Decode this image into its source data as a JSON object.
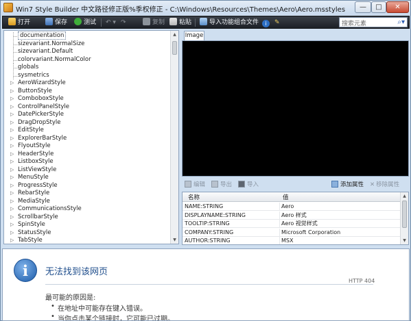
{
  "window": {
    "title": "Win7 Style Builder 中文路径修正版%季权修正 - C:\\Windows\\Resources\\Themes\\Aero\\Aero.msstyles",
    "minimize_glyph": "—",
    "maximize_glyph": "□",
    "close_glyph": "✕"
  },
  "toolbar": {
    "open": "打开",
    "save": "保存",
    "test": "测试",
    "copy": "复制",
    "paste": "粘贴",
    "import_combo": "导入功能组合文件",
    "search_placeholder": "搜索元素"
  },
  "tree": {
    "items": [
      {
        "label": "documentation",
        "expandable": false,
        "selected": true
      },
      {
        "label": "sizevariant.NormalSize",
        "expandable": false
      },
      {
        "label": "sizevariant.Default",
        "expandable": false
      },
      {
        "label": "colorvariant.NormalColor",
        "expandable": false
      },
      {
        "label": "globals",
        "expandable": false
      },
      {
        "label": "sysmetrics",
        "expandable": false
      },
      {
        "label": "AeroWizardStyle",
        "expandable": true
      },
      {
        "label": "ButtonStyle",
        "expandable": true
      },
      {
        "label": "ComboboxStyle",
        "expandable": true
      },
      {
        "label": "ControlPanelStyle",
        "expandable": true
      },
      {
        "label": "DatePickerStyle",
        "expandable": true
      },
      {
        "label": "DragDropStyle",
        "expandable": true
      },
      {
        "label": "EditStyle",
        "expandable": true
      },
      {
        "label": "ExplorerBarStyle",
        "expandable": true
      },
      {
        "label": "FlyoutStyle",
        "expandable": true
      },
      {
        "label": "HeaderStyle",
        "expandable": true
      },
      {
        "label": "ListboxStyle",
        "expandable": true
      },
      {
        "label": "ListViewStyle",
        "expandable": true
      },
      {
        "label": "MenuStyle",
        "expandable": true
      },
      {
        "label": "ProgressStyle",
        "expandable": true
      },
      {
        "label": "RebarStyle",
        "expandable": true
      },
      {
        "label": "MediaStyle",
        "expandable": true
      },
      {
        "label": "CommunicationsStyle",
        "expandable": true
      },
      {
        "label": "ScrollbarStyle",
        "expandable": true
      },
      {
        "label": "SpinStyle",
        "expandable": true
      },
      {
        "label": "StatusStyle",
        "expandable": true
      },
      {
        "label": "TabStyle",
        "expandable": true
      }
    ]
  },
  "image_tab": {
    "label": "Image"
  },
  "image_toolbar": {
    "edit": "编辑",
    "export": "导出",
    "import": "导入",
    "add_property": "添加属性",
    "remove_property": "移除属性"
  },
  "properties": {
    "col_name": "名称",
    "col_value": "值",
    "rows": [
      {
        "name": "NAME:STRING",
        "value": "Aero"
      },
      {
        "name": "DISPLAYNAME:STRING",
        "value": "Aero 样式"
      },
      {
        "name": "TOOLTIP:STRING",
        "value": "Aero 视觉样式"
      },
      {
        "name": "COMPANY:STRING",
        "value": "Microsoft Corporation"
      },
      {
        "name": "AUTHOR:STRING",
        "value": "MSX"
      }
    ]
  },
  "browser_error": {
    "title": "无法找到该网页",
    "code": "HTTP 404",
    "cause_heading": "最可能的原因是:",
    "bullets": [
      "在地址中可能存在键入错误。",
      "当你点击某个链接时，它可能已过期。"
    ]
  },
  "colors": {
    "toolbar_bg": "#1c2026",
    "accent_blue": "#1f4e8c",
    "image_bg": "#000000"
  }
}
